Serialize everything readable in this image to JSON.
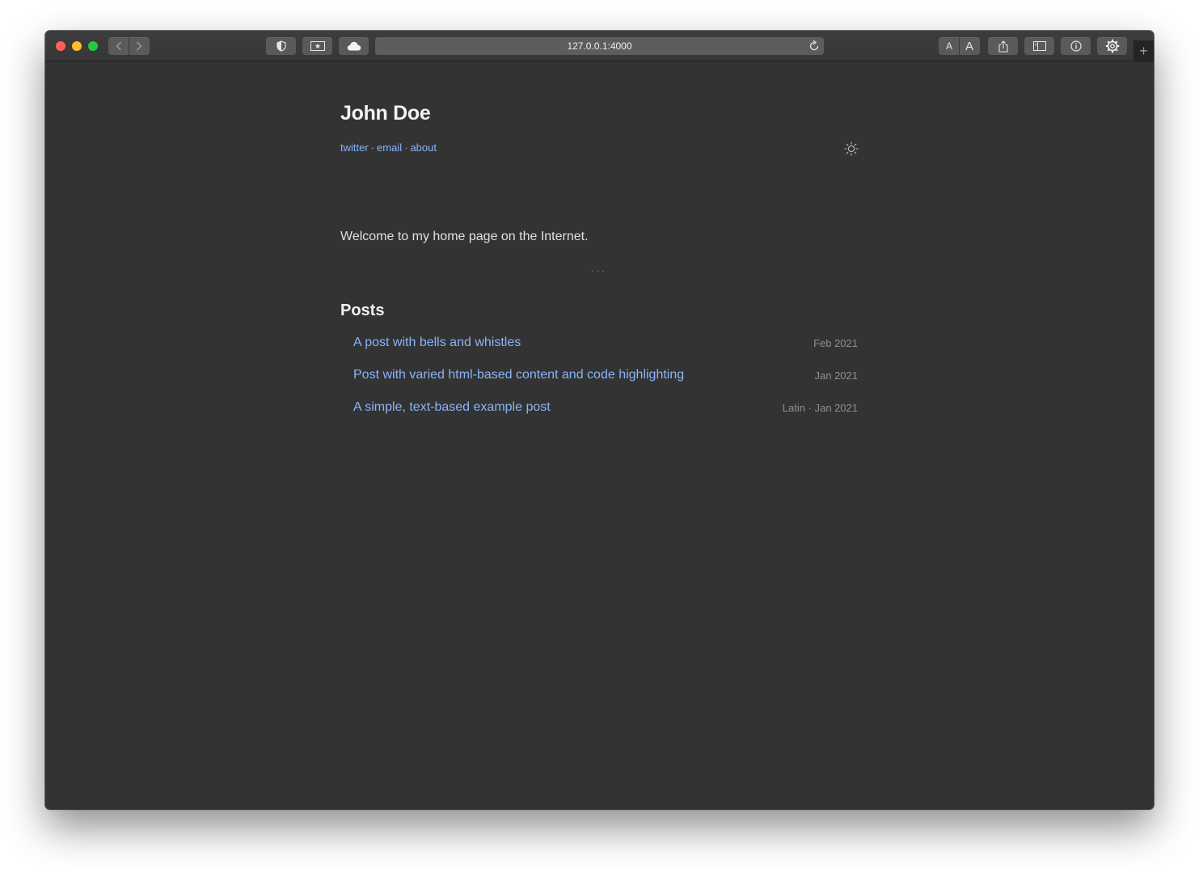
{
  "browser": {
    "url": "127.0.0.1:4000",
    "font_small_label": "A",
    "font_large_label": "A",
    "new_tab_label": "+"
  },
  "site": {
    "title": "John Doe",
    "nav": [
      {
        "label": "twitter"
      },
      {
        "label": "email"
      },
      {
        "label": "about"
      }
    ],
    "nav_separator": "·",
    "welcome": "Welcome to my home page on the Internet.",
    "divider": "...",
    "posts_heading": "Posts",
    "posts": [
      {
        "title": "A post with bells and whistles",
        "meta": "Feb 2021"
      },
      {
        "title": "Post with varied html-based content and code highlighting",
        "meta": "Jan 2021"
      },
      {
        "title": "A simple, text-based example post",
        "meta": "Latin · Jan 2021"
      }
    ]
  },
  "colors": {
    "background": "#333333",
    "link": "#8ab4f8",
    "text": "#e0e0e0",
    "muted": "#8f8f8f"
  },
  "icons": {
    "theme_toggle": "sun-icon"
  }
}
